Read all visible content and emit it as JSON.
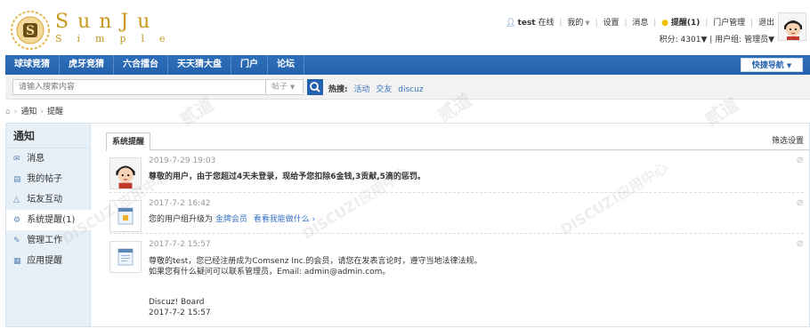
{
  "logo": {
    "line1": "SunJu",
    "line2": "Simple",
    "letter": "S"
  },
  "userbar": {
    "username": "test",
    "status": "在线",
    "my": "我的",
    "settings": "设置",
    "messages": "消息",
    "reminders": "提醒(1)",
    "portal_admin": "门户管理",
    "logout": "退出",
    "points": "积分: 4301",
    "usergroup": "用户组: 管理员"
  },
  "nav": {
    "items": [
      "球球竞猜",
      "虎牙竞猜",
      "六合擂台",
      "天天猜大盘",
      "门户",
      "论坛"
    ],
    "quick_nav": "快捷导航"
  },
  "search": {
    "placeholder": "请输入搜索内容",
    "type": "帖子",
    "hot_label": "热搜:",
    "hot_keywords": [
      "活动",
      "交友",
      "discuz"
    ]
  },
  "breadcrumb": {
    "items": [
      "通知",
      "提醒"
    ]
  },
  "sidebar": {
    "title": "通知",
    "items": [
      {
        "label": "消息",
        "icon": "envelope-icon"
      },
      {
        "label": "我的帖子",
        "icon": "document-icon"
      },
      {
        "label": "坛友互动",
        "icon": "triangle-icon"
      },
      {
        "label": "系统提醒(1)",
        "icon": "gear-icon"
      },
      {
        "label": "管理工作",
        "icon": "wrench-icon"
      },
      {
        "label": "应用提醒",
        "icon": "grid-icon"
      }
    ],
    "active_index": 3
  },
  "content": {
    "tab": "系统提醒",
    "filter": "筛选设置",
    "notices": [
      {
        "time": "2019-7-29 19:03",
        "text": "尊敬的用户，由于您超过4天未登录，现给予您扣除6金钱,3贡献,5滴的惩罚。"
      },
      {
        "time": "2017-7-2 16:42",
        "text_before": "您的用户组升级为",
        "group": "金牌会员",
        "link": "看看我能做什么 ›"
      },
      {
        "time": "2017-7-2 15:57",
        "line1": "尊敬的test，您已经注册成为Comsenz Inc.的会员，请您在发表言论时，遵守当地法律法规。",
        "line2": "如果您有什么疑问可以联系管理员，Email: admin@admin.com。",
        "sign": "Discuz! Board",
        "sign_time": "2017-7-2 15:57"
      }
    ]
  },
  "watermark": {
    "text1": "DISCUZ!应用中心",
    "text2": "addon.dismall.com",
    "text3": "贰道"
  },
  "colors": {
    "nav": "#2462ad",
    "link": "#3a74c4",
    "sidebar": "#e8f0f7",
    "logo": "#c8971c"
  }
}
